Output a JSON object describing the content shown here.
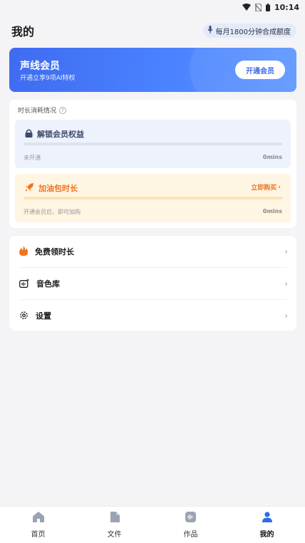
{
  "status_bar": {
    "time": "10:14",
    "icons": [
      "wifi-icon",
      "no-sim-icon",
      "battery-icon"
    ]
  },
  "header": {
    "title": "我的",
    "quota_chip": "每月1800分钟合成额度",
    "quota_icon": "mic-icon"
  },
  "vip": {
    "title": "声线会员",
    "subtitle": "开通立享9项AI特权",
    "button": "开通会员"
  },
  "usage": {
    "heading": "时长消耗情况",
    "unlock": {
      "title": "解锁会员权益",
      "status": "未开通",
      "value": "0mins",
      "progress": 0
    },
    "fuel": {
      "title": "加油包时长",
      "action": "立即购买",
      "note": "开通会员后，即可加购",
      "value": "0mins",
      "progress": 0
    }
  },
  "menu": {
    "items": [
      {
        "label": "免费领时长",
        "icon": "flame-icon"
      },
      {
        "label": "音色库",
        "icon": "voice-library-icon"
      },
      {
        "label": "设置",
        "icon": "gear-icon"
      }
    ]
  },
  "tabs": [
    {
      "label": "首页",
      "icon": "home-icon",
      "active": false
    },
    {
      "label": "文件",
      "icon": "file-icon",
      "active": false
    },
    {
      "label": "作品",
      "icon": "works-icon",
      "active": false
    },
    {
      "label": "我的",
      "icon": "profile-icon",
      "active": true
    }
  ],
  "colors": {
    "accent": "#4a82ff",
    "orange": "#f07521",
    "background": "#f4f4f6"
  }
}
